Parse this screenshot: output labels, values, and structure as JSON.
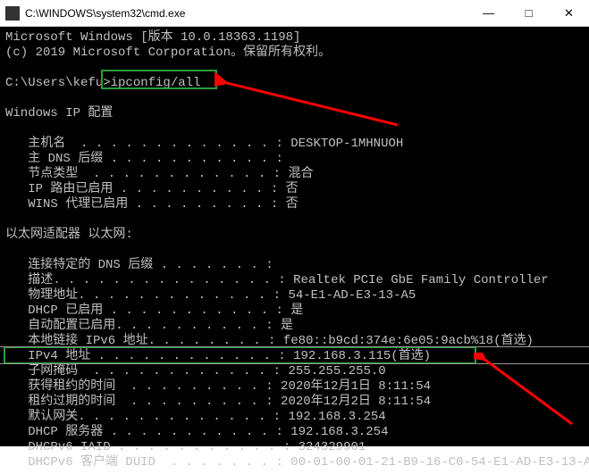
{
  "titlebar": {
    "title": "C:\\WINDOWS\\system32\\cmd.exe",
    "min": "—",
    "max": "□",
    "close": "✕"
  },
  "console": {
    "header1": "Microsoft Windows [版本 10.0.18363.1198]",
    "header2": "(c) 2019 Microsoft Corporation。保留所有权利。",
    "prompt": "C:\\Users\\kefu>",
    "command": "ipconfig/all",
    "section1": "Windows IP 配置",
    "host_label": "   主机名  . . . . . . . . . . . . . : ",
    "host_val": "DESKTOP-1MHNUOH",
    "dns_suffix_label": "   主 DNS 后缀 . . . . . . . . . . . :",
    "node_label": "   节点类型  . . . . . . . . . . . . : ",
    "node_val": "混合",
    "iprouting_label": "   IP 路由已启用 . . . . . . . . . . : ",
    "iprouting_val": "否",
    "wins_label": "   WINS 代理已启用 . . . . . . . . . : ",
    "wins_val": "否",
    "section2": "以太网适配器 以太网:",
    "conn_dns_label": "   连接特定的 DNS 后缀 . . . . . . . :",
    "desc_label": "   描述. . . . . . . . . . . . . . . : ",
    "desc_val": "Realtek PCIe GbE Family Controller",
    "mac_label": "   物理地址. . . . . . . . . . . . . : ",
    "mac_val": "54-E1-AD-E3-13-A5",
    "dhcp_label": "   DHCP 已启用 . . . . . . . . . . . : ",
    "dhcp_val": "是",
    "autoconf_label": "   自动配置已启用. . . . . . . . . . : ",
    "autoconf_val": "是",
    "ipv6_label": "   本地链接 IPv6 地址. . . . . . . . : ",
    "ipv6_val": "fe80::b9cd:374e:6e05:9acb%18(首选)",
    "ipv4_label": "   IPv4 地址 . . . . . . . . . . . . : ",
    "ipv4_val": "192.168.3.115(首选)",
    "subnet_label": "   子网掩码  . . . . . . . . . . . . : ",
    "subnet_val": "255.255.255.0",
    "lease_obt_label": "   获得租约的时间  . . . . . . . . . : ",
    "lease_obt_val": "2020年12月1日 8:11:54",
    "lease_exp_label": "   租约过期的时间  . . . . . . . . . : ",
    "lease_exp_val": "2020年12月2日 8:11:54",
    "gateway_label": "   默认网关. . . . . . . . . . . . . : ",
    "gateway_val": "192.168.3.254",
    "dhcpsrv_label": "   DHCP 服务器 . . . . . . . . . . . : ",
    "dhcpsrv_val": "192.168.3.254",
    "iaid_label": "   DHCPv6 IAID . . . . . . . . . . . : ",
    "iaid_val": "324329901",
    "duid_label": "   DHCPv6 客户端 DUID  . . . . . . . : ",
    "duid_val": "00-01-00-01-21-B9-16-C0-54-E1-AD-E3-13-A"
  }
}
